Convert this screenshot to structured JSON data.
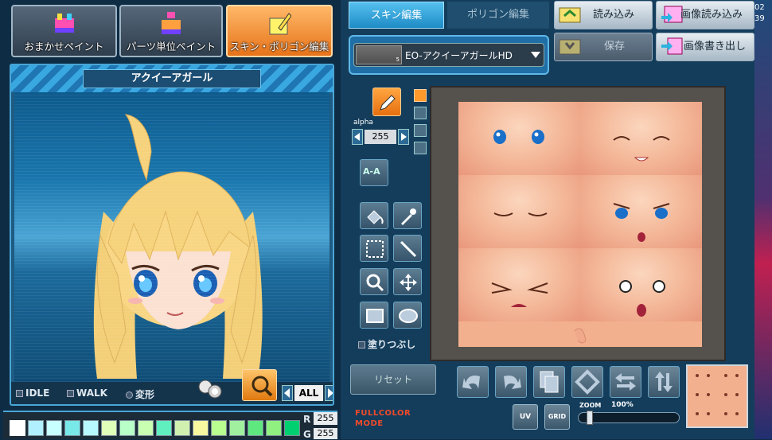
{
  "mode_buttons": [
    {
      "label": "おまかせペイント"
    },
    {
      "label": "パーツ単位ペイント"
    },
    {
      "label": "スキン・ポリゴン編集"
    }
  ],
  "preview": {
    "title": "アクイーアガール",
    "options": {
      "idle": "IDLE",
      "walk": "WALK",
      "transform": "変形"
    },
    "filter_value": "ALL"
  },
  "palette": {
    "colors": [
      "#ffffff",
      "#b0f0ff",
      "#c8ffff",
      "#78e8e8",
      "#b8f8ff",
      "#e0ffb8",
      "#b8ffc8",
      "#c8ffb0",
      "#60f0c0",
      "#d0f0b0",
      "#f8f8a0",
      "#b8ff90",
      "#a0f0a0",
      "#60e880",
      "#90f080",
      "#00d070"
    ],
    "r_label": "R",
    "r_value": "255",
    "g_label": "G",
    "g_value": "255"
  },
  "tabs": {
    "skin": "スキン編集",
    "polygon": "ポリゴン編集"
  },
  "file": {
    "load": "読み込み",
    "image_load": "画像読み込み",
    "save": "保存",
    "image_export": "画像書き出し"
  },
  "model_select": {
    "value": "EO-アクイーアガールHD",
    "swatch_number": "5"
  },
  "tools": {
    "alpha_label": "alpha",
    "alpha_value": "255",
    "fill_label": "塗りつぶし",
    "aa_label": "A-A"
  },
  "bottom": {
    "reset": "リセット",
    "mode_line1": "FULLCOLOR",
    "mode_line2": "MODE",
    "uv": "UV",
    "grid": "GRID",
    "zoom_label": "ZOOM",
    "zoom_value": "100%"
  },
  "edge_text": [
    "02",
    "39"
  ],
  "colors": {
    "accent": "#f28a1e",
    "panel": "#143d5c",
    "highlight": "#4aa6d6"
  }
}
